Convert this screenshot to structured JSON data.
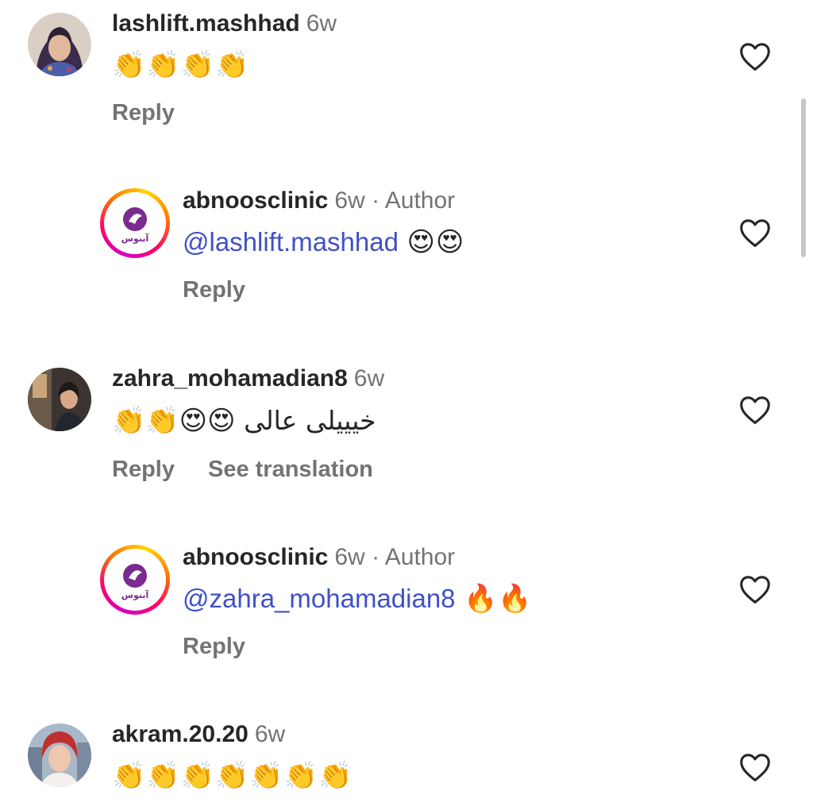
{
  "comments": [
    {
      "username": "lashlift.mashhad",
      "time": "6w",
      "text": "👏👏👏👏",
      "actions": {
        "reply": "Reply"
      }
    },
    {
      "username": "abnoosclinic",
      "time": "6w",
      "author_label": "· Author",
      "mention": "@lashlift.mashhad",
      "emojis": "😍😍",
      "actions": {
        "reply": "Reply"
      },
      "logo_text": "آبنوس"
    },
    {
      "username": "zahra_mohamadian8",
      "time": "6w",
      "text_rtl": "خیییلی عالی",
      "emojis": "👏👏😍😍",
      "actions": {
        "reply": "Reply",
        "translate": "See translation"
      }
    },
    {
      "username": "abnoosclinic",
      "time": "6w",
      "author_label": "· Author",
      "mention": "@zahra_mohamadian8",
      "emojis": "🔥🔥",
      "actions": {
        "reply": "Reply"
      },
      "logo_text": "آبنوس"
    },
    {
      "username": "akram.20.20",
      "time": "6w",
      "text": "👏👏👏👏👏👏👏"
    }
  ],
  "colors": {
    "mention": "#3f51c4",
    "meta": "#737373",
    "text": "#262626",
    "brand_purple": "#7b2a8f"
  },
  "icons": {
    "like": "heart-outline-icon"
  }
}
